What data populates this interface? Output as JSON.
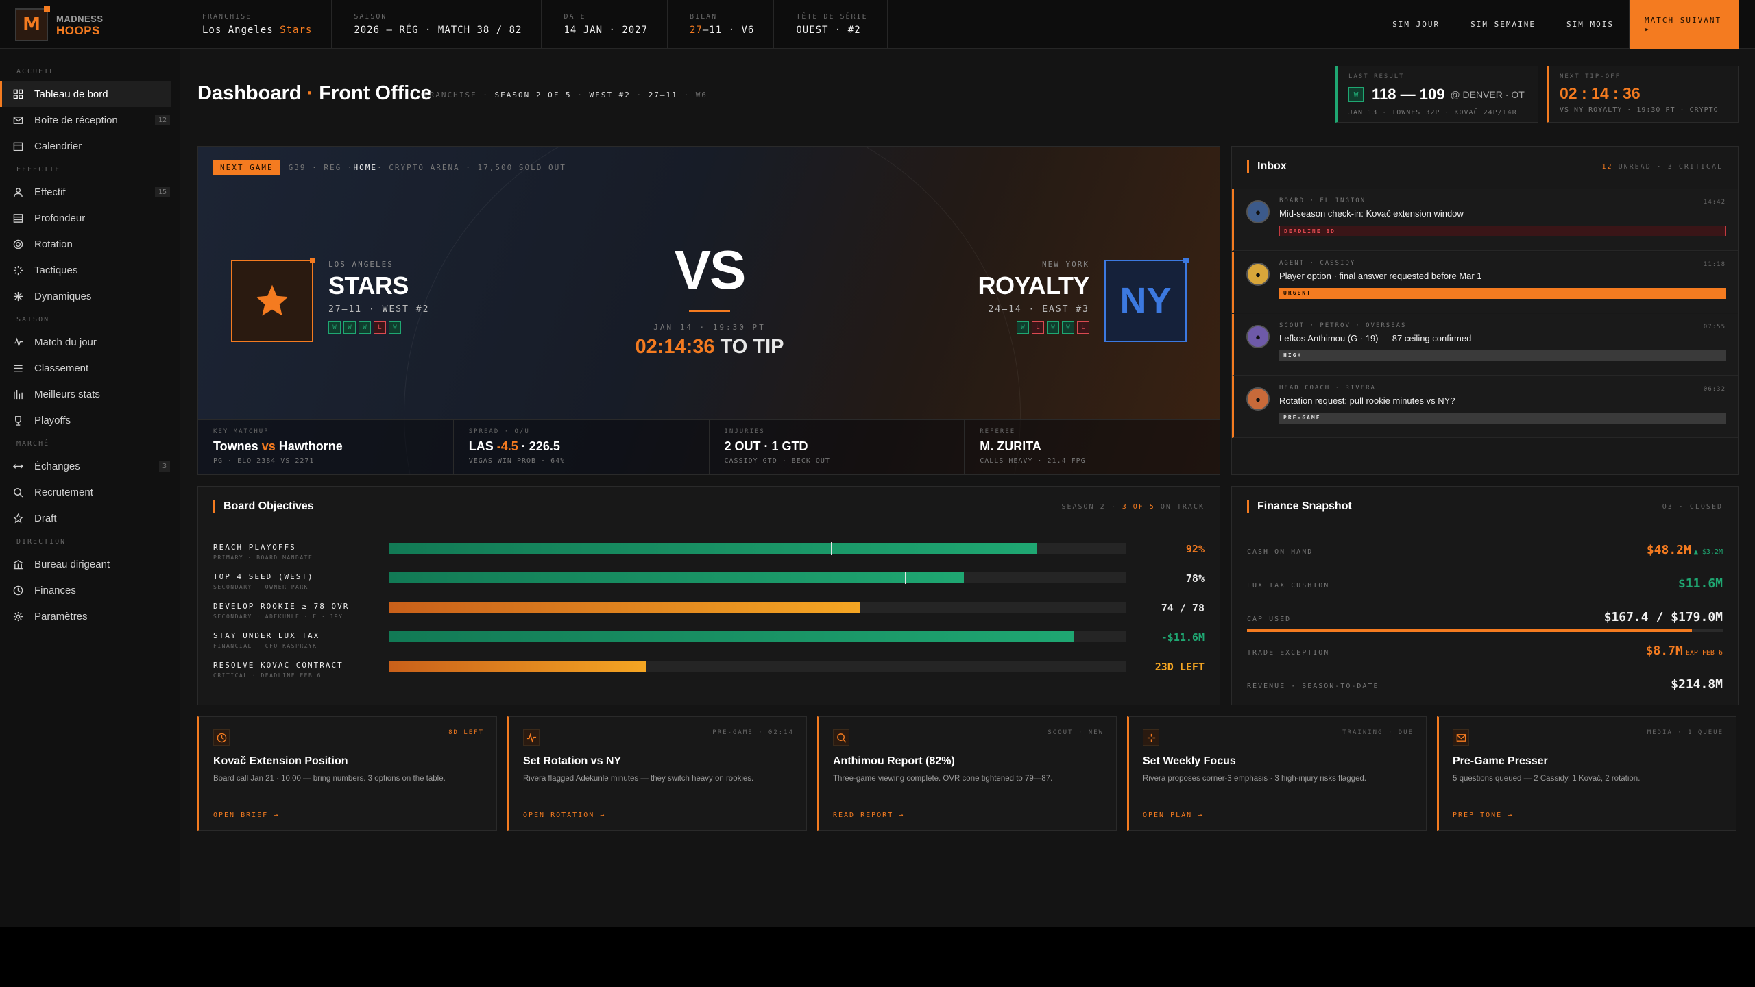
{
  "brand": {
    "line1": "MADNESS",
    "line2": "HOOPS",
    "mark": "M"
  },
  "header": {
    "stats": [
      {
        "label": "FRANCHISE",
        "value_pre": "Los Angeles ",
        "value_accent": "Stars",
        "value_post": ""
      },
      {
        "label": "SAISON",
        "value_pre": "2026 — RÉG · MATCH 38 / 82",
        "value_accent": "",
        "value_post": ""
      },
      {
        "label": "DATE",
        "value_pre": "14 JAN · 2027",
        "value_accent": "",
        "value_post": ""
      },
      {
        "label": "BILAN",
        "value_pre": "",
        "value_accent": "27",
        "value_post": "—11 · V6"
      },
      {
        "label": "TÊTE DE SÉRIE",
        "value_pre": "OUEST · #2",
        "value_accent": "",
        "value_post": ""
      }
    ],
    "sim_day": "SIM JOUR",
    "sim_week": "SIM SEMAINE",
    "sim_month": "SIM MOIS",
    "next_match": "MATCH SUIVANT ▸"
  },
  "sidebar": {
    "sections": [
      {
        "title": "ACCUEIL",
        "items": [
          {
            "label": "Tableau de bord",
            "icon": "grid-icon",
            "active": true,
            "badge": ""
          },
          {
            "label": "Boîte de réception",
            "icon": "mail-icon",
            "active": false,
            "badge": "12"
          },
          {
            "label": "Calendrier",
            "icon": "calendar-icon",
            "active": false,
            "badge": ""
          }
        ]
      },
      {
        "title": "EFFECTIF",
        "items": [
          {
            "label": "Effectif",
            "icon": "user-icon",
            "active": false,
            "badge": "15"
          },
          {
            "label": "Profondeur",
            "icon": "depth-icon",
            "active": false,
            "badge": ""
          },
          {
            "label": "Rotation",
            "icon": "target-icon",
            "active": false,
            "badge": ""
          },
          {
            "label": "Tactiques",
            "icon": "tactics-icon",
            "active": false,
            "badge": ""
          },
          {
            "label": "Dynamiques",
            "icon": "dynamics-icon",
            "active": false,
            "badge": ""
          }
        ]
      },
      {
        "title": "SAISON",
        "items": [
          {
            "label": "Match du jour",
            "icon": "pulse-icon",
            "active": false,
            "badge": ""
          },
          {
            "label": "Classement",
            "icon": "list-icon",
            "active": false,
            "badge": ""
          },
          {
            "label": "Meilleurs stats",
            "icon": "bars-icon",
            "active": false,
            "badge": ""
          },
          {
            "label": "Playoffs",
            "icon": "trophy-icon",
            "active": false,
            "badge": ""
          }
        ]
      },
      {
        "title": "MARCHÉ",
        "items": [
          {
            "label": "Échanges",
            "icon": "swap-icon",
            "active": false,
            "badge": "3"
          },
          {
            "label": "Recrutement",
            "icon": "search-icon",
            "active": false,
            "badge": ""
          },
          {
            "label": "Draft",
            "icon": "star-icon",
            "active": false,
            "badge": ""
          }
        ]
      },
      {
        "title": "DIRECTION",
        "items": [
          {
            "label": "Bureau dirigeant",
            "icon": "bank-icon",
            "active": false,
            "badge": ""
          },
          {
            "label": "Finances",
            "icon": "clock-icon",
            "active": false,
            "badge": ""
          },
          {
            "label": "Paramètres",
            "icon": "gear-icon",
            "active": false,
            "badge": ""
          }
        ]
      }
    ]
  },
  "page": {
    "title_a": "Dashboard",
    "dot": "·",
    "title_b": "Front Office",
    "meta": [
      {
        "t": "FRANCHISE",
        "b": false
      },
      {
        "t": "·",
        "b": false
      },
      {
        "t": "SEASON 2 OF 5",
        "b": true
      },
      {
        "t": "·",
        "b": false
      },
      {
        "t": "WEST #2",
        "b": true
      },
      {
        "t": "·",
        "b": false
      },
      {
        "t": "27–11",
        "b": true
      },
      {
        "t": "·",
        "b": false
      },
      {
        "t": "W6",
        "b": false
      }
    ]
  },
  "last_result": {
    "label": "LAST RESULT",
    "wl": "W",
    "score": "118 — 109",
    "opp": "@ DENVER · OT",
    "sub": "JAN 13 · TOWNES 32P · KOVAČ 24P/14R"
  },
  "next_tip": {
    "label": "NEXT TIP-OFF",
    "countdown": "02 : 14 : 36",
    "sub": "VS NY ROYALTY · 19:30 PT · CRYPTO"
  },
  "hero": {
    "tag": "NEXT GAME",
    "info_pre": "G39 · REG · ",
    "info_home": "HOME",
    "info_post": " · CRYPTO ARENA · 17,500 SOLD OUT",
    "home": {
      "city": "LOS ANGELES",
      "name": "STARS",
      "record": "27–11 · WEST #2",
      "form": [
        "W",
        "W",
        "W",
        "L",
        "W"
      ]
    },
    "away": {
      "city": "NEW YORK",
      "name": "ROYALTY",
      "record": "24–14 · EAST #3",
      "abbr": "NY",
      "form": [
        "W",
        "L",
        "W",
        "W",
        "L"
      ]
    },
    "vs": "VS",
    "time": "JAN 14 · 19:30 PT",
    "countdown": "02:14:36",
    "countdown_suffix": " TO TIP",
    "footer": [
      {
        "label": "KEY MATCHUP",
        "v1": "Townes ",
        "v2": "vs",
        "v3": " Hawthorne",
        "sub": "PG · ELO 2384 VS 2271"
      },
      {
        "label": "SPREAD · O/U",
        "v1": "LAS ",
        "v2": "-4.5",
        "v3": " · 226.5",
        "sub": "VEGAS WIN PROB · 64%"
      },
      {
        "label": "INJURIES",
        "v1": "2 OUT · 1 GTD",
        "v2": "",
        "v3": "",
        "sub": "CASSIDY GTD · BECK OUT"
      },
      {
        "label": "REFEREE",
        "v1": "M. ZURITA",
        "v2": "",
        "v3": "",
        "sub": "CALLS HEAVY · 21.4 FPG"
      }
    ]
  },
  "inbox": {
    "title": "Inbox",
    "meta_count": "12",
    "meta_rest": " UNREAD · 3 CRITICAL",
    "messages": [
      {
        "from": "BOARD · ELLINGTON",
        "time": "14:42",
        "subject": "Mid-season check-in: Kovač extension window",
        "tag": "DEADLINE 8D",
        "tag_type": "deadline",
        "avatar_color": "#3c5a8a"
      },
      {
        "from": "AGENT · CASSIDY",
        "time": "11:18",
        "subject": "Player option · final answer requested before Mar 1",
        "tag": "URGENT",
        "tag_type": "urgent",
        "avatar_color": "#d8a63a"
      },
      {
        "from": "SCOUT · PETROV · OVERSEAS",
        "time": "07:55",
        "subject": "Lefkos Anthimou (G · 19) — 87 ceiling confirmed",
        "tag": "HIGH",
        "tag_type": "high",
        "avatar_color": "#6e5aa8"
      },
      {
        "from": "HEAD COACH · RIVERA",
        "time": "06:32",
        "subject": "Rotation request: pull rookie minutes vs NY?",
        "tag": "PRE-GAME",
        "tag_type": "pregame",
        "avatar_color": "#c86a3a"
      }
    ]
  },
  "objectives": {
    "title": "Board Objectives",
    "meta_pre": "SEASON 2 · ",
    "meta_accent": "3 OF 5",
    "meta_post": " ON TRACK",
    "items": [
      {
        "name": "REACH PLAYOFFS",
        "desc": "PRIMARY · BOARD MANDATE",
        "progress": 0.88,
        "marker": 0.6,
        "value": "92%",
        "color": "g",
        "value_color": "#f47b20"
      },
      {
        "name": "TOP 4 SEED (WEST)",
        "desc": "SECONDARY · OWNER PARK",
        "progress": 0.78,
        "marker": 0.7,
        "value": "78%",
        "color": "g",
        "value_color": "#e8e8e8"
      },
      {
        "name": "DEVELOP ROOKIE ≥ 78 OVR",
        "desc": "SECONDARY · ADEKUNLE · F · 19Y",
        "progress": 0.64,
        "marker": null,
        "value": "74 / 78",
        "color": "o",
        "value_color": "#e8e8e8"
      },
      {
        "name": "STAY UNDER LUX TAX",
        "desc": "FINANCIAL · CFO KASPRZYK",
        "progress": 0.93,
        "marker": null,
        "value": "-$11.6M",
        "color": "g",
        "value_color": "#1fa772"
      },
      {
        "name": "RESOLVE KOVAČ CONTRACT",
        "desc": "CRITICAL · DEADLINE FEB 6",
        "progress": 0.35,
        "marker": null,
        "value": "23D LEFT",
        "color": "o",
        "value_color": "#f5a623"
      }
    ]
  },
  "finance": {
    "title": "Finance Snapshot",
    "meta": "Q3 · CLOSED",
    "rows": [
      {
        "label": "CASH ON HAND",
        "value": "$48.2M",
        "note": "▲ $3.2M",
        "color": "#f47b20",
        "note_color": "#1fa772"
      },
      {
        "label": "LUX TAX CUSHION",
        "value": "$11.6M",
        "note": "",
        "color": "#1fa772",
        "note_color": ""
      },
      {
        "label": "CAP USED",
        "value": "$167.4 / $179.0M",
        "note": "",
        "color": "#f0f0f0",
        "note_color": ""
      },
      {
        "label": "TRADE EXCEPTION",
        "value": "$8.7M",
        "note": "EXP FEB 6",
        "color": "#f47b20",
        "note_color": "#f47b20"
      },
      {
        "label": "REVENUE · SEASON-TO-DATE",
        "value": "$214.8M",
        "note": "",
        "color": "#f0f0f0",
        "note_color": ""
      }
    ],
    "cap_fraction": 0.935
  },
  "cards": [
    {
      "icon": "clock-icon",
      "meta": "8D LEFT",
      "meta_accent": true,
      "title": "Kovač Extension Position",
      "body": "Board call Jan 21 · 10:00 — bring numbers. 3 options on the table.",
      "cta": "OPEN BRIEF →"
    },
    {
      "icon": "pulse-icon",
      "meta": "PRE-GAME · 02:14",
      "meta_accent": false,
      "title": "Set Rotation vs NY",
      "body": "Rivera flagged Adekunle minutes — they switch heavy on rookies.",
      "cta": "OPEN ROTATION →"
    },
    {
      "icon": "search-icon",
      "meta": "SCOUT · NEW",
      "meta_accent": false,
      "title": "Anthimou Report (82%)",
      "body": "Three-game viewing complete. OVR cone tightened to 79—87.",
      "cta": "READ REPORT →"
    },
    {
      "icon": "sparkle-icon",
      "meta": "TRAINING · DUE",
      "meta_accent": false,
      "title": "Set Weekly Focus",
      "body": "Rivera proposes corner-3 emphasis · 3 high-injury risks flagged.",
      "cta": "OPEN PLAN →"
    },
    {
      "icon": "mail-icon",
      "meta": "MEDIA · 1 QUEUE",
      "meta_accent": false,
      "title": "Pre-Game Presser",
      "body": "5 questions queued — 2 Cassidy, 1 Kovač, 2 rotation.",
      "cta": "PREP TONE →"
    }
  ]
}
